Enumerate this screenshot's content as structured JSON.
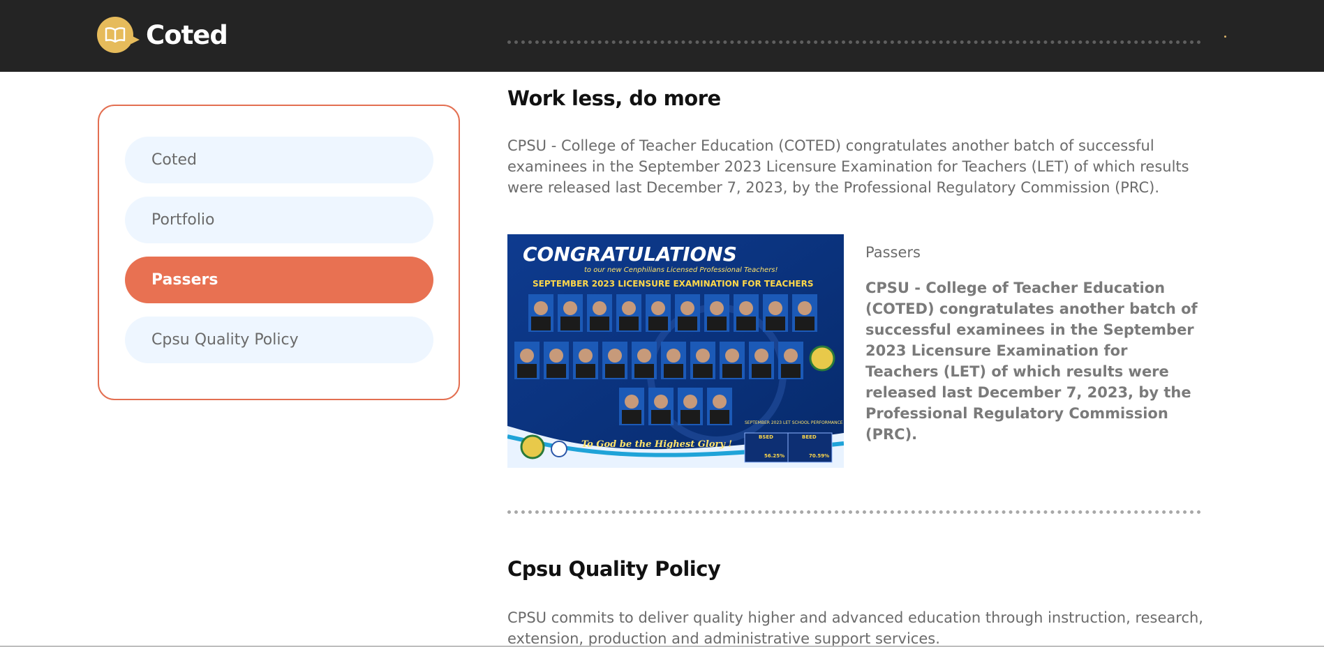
{
  "brand": {
    "name": "Coted",
    "logo_icon": "open-book-icon"
  },
  "colors": {
    "accent": "#e87152",
    "header_bg": "#242424",
    "logo": "#e6bb5b",
    "pill_bg": "#eef6ff"
  },
  "sidebar": {
    "items": [
      {
        "label": "Coted",
        "active": false
      },
      {
        "label": "Portfolio",
        "active": false
      },
      {
        "label": "Passers",
        "active": true
      },
      {
        "label": "Cpsu Quality Policy",
        "active": false
      }
    ]
  },
  "section1": {
    "title": "Work less, do more",
    "body": "CPSU - College of Teacher Education (COTED) congratulates another batch of successful examinees in the September 2023 Licensure Examination for Teachers (LET) of which results were released last December 7, 2023, by the Professional Regulatory Commission (PRC).",
    "image": {
      "heading": "CONGRATULATIONS",
      "subheading": "to our new Cenphilians Licensed Professional Teachers!",
      "banner": "SEPTEMBER 2023 LICENSURE EXAMINATION FOR TEACHERS",
      "motto": "To God be the Highest Glory !",
      "perf_title": "SEPTEMBER 2023 LET SCHOOL PERFORMANCE",
      "perf_cols": [
        "BSED",
        "BEED"
      ],
      "perf_values": [
        "56.25%",
        "70.59%"
      ]
    },
    "side_title": "Passers",
    "side_body": "CPSU - College of Teacher Education (COTED) congratulates another batch of successful examinees in the September 2023 Licensure Examination for Teachers (LET) of which results were released last December 7, 2023, by the Professional Regulatory Commission (PRC)."
  },
  "section2": {
    "title": "Cpsu Quality Policy",
    "body": "CPSU commits to deliver quality higher and advanced education through instruction, research, extension, production and administrative support services."
  }
}
